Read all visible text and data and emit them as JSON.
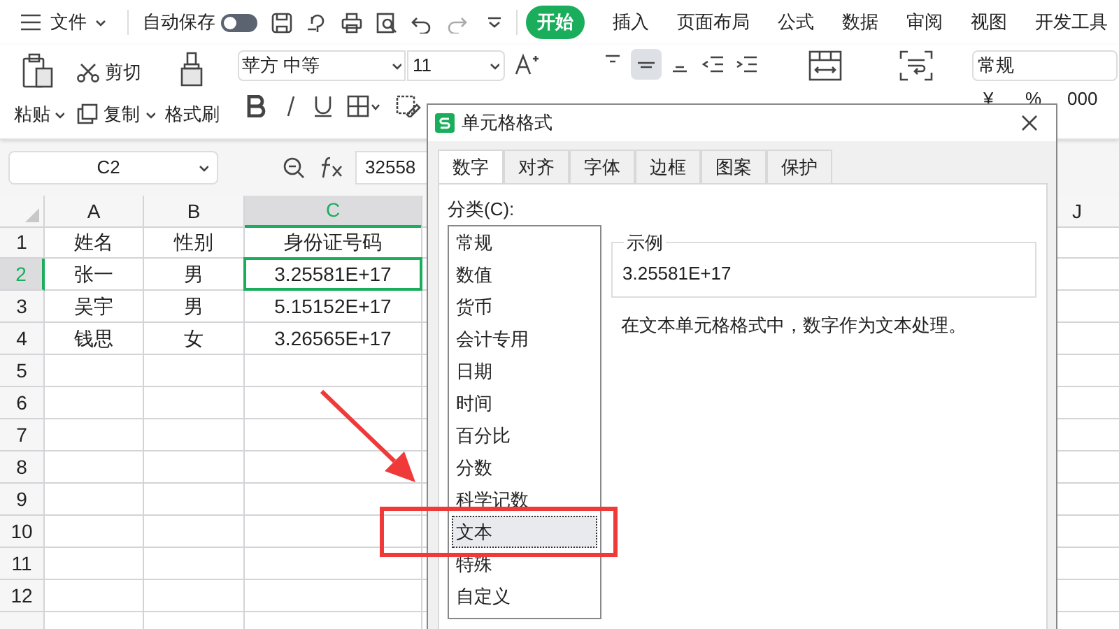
{
  "menu_bar": {
    "file_label": "文件",
    "autosave": {
      "label": "自动保存",
      "on": false
    },
    "tabs": [
      {
        "label": "开始",
        "selected": true
      },
      {
        "label": "插入",
        "selected": false
      },
      {
        "label": "页面布局",
        "selected": false
      },
      {
        "label": "公式",
        "selected": false
      },
      {
        "label": "数据",
        "selected": false
      },
      {
        "label": "审阅",
        "selected": false
      },
      {
        "label": "视图",
        "selected": false
      },
      {
        "label": "开发工具",
        "selected": false
      }
    ]
  },
  "ribbon": {
    "paste": "粘贴",
    "cut": "剪切",
    "copy": "复制",
    "format_painter": "格式刷",
    "font_name": "苹方 中等",
    "font_size": "11",
    "number_format": "常规",
    "number_buttons": [
      "¥",
      "%",
      "000"
    ]
  },
  "formula_bar": {
    "name_box": "C2",
    "value": "32558"
  },
  "sheet": {
    "columns": [
      {
        "label": "A",
        "selected": false
      },
      {
        "label": "B",
        "selected": false
      },
      {
        "label": "C",
        "selected": true
      }
    ],
    "right_column": "J",
    "rows": [
      {
        "number": "1",
        "selected": false,
        "cells": [
          {
            "text": "姓名",
            "selected": false
          },
          {
            "text": "性别",
            "selected": false
          },
          {
            "text": "身份证号码",
            "selected": false
          }
        ]
      },
      {
        "number": "2",
        "selected": true,
        "cells": [
          {
            "text": "张一",
            "selected": false
          },
          {
            "text": "男",
            "selected": false
          },
          {
            "text": "3.25581E+17",
            "selected": true
          }
        ]
      },
      {
        "number": "3",
        "selected": false,
        "cells": [
          {
            "text": "吴宇",
            "selected": false
          },
          {
            "text": "男",
            "selected": false
          },
          {
            "text": "5.15152E+17",
            "selected": false
          }
        ]
      },
      {
        "number": "4",
        "selected": false,
        "cells": [
          {
            "text": "钱思",
            "selected": false
          },
          {
            "text": "女",
            "selected": false
          },
          {
            "text": "3.26565E+17",
            "selected": false
          }
        ]
      },
      {
        "number": "5",
        "selected": false
      },
      {
        "number": "6",
        "selected": false
      },
      {
        "number": "7",
        "selected": false
      },
      {
        "number": "8",
        "selected": false
      },
      {
        "number": "9",
        "selected": false
      },
      {
        "number": "10",
        "selected": false
      },
      {
        "number": "11",
        "selected": false
      },
      {
        "number": "12",
        "selected": false
      }
    ]
  },
  "dialog": {
    "title": "单元格格式",
    "tabs": [
      {
        "label": "数字",
        "selected": true
      },
      {
        "label": "对齐",
        "selected": false
      },
      {
        "label": "字体",
        "selected": false
      },
      {
        "label": "边框",
        "selected": false
      },
      {
        "label": "图案",
        "selected": false
      },
      {
        "label": "保护",
        "selected": false
      }
    ],
    "category_label": "分类(C):",
    "categories": [
      {
        "label": "常规",
        "selected": false
      },
      {
        "label": "数值",
        "selected": false
      },
      {
        "label": "货币",
        "selected": false
      },
      {
        "label": "会计专用",
        "selected": false
      },
      {
        "label": "日期",
        "selected": false
      },
      {
        "label": "时间",
        "selected": false
      },
      {
        "label": "百分比",
        "selected": false
      },
      {
        "label": "分数",
        "selected": false
      },
      {
        "label": "科学记数",
        "selected": false
      },
      {
        "label": "文本",
        "selected": true
      },
      {
        "label": "特殊",
        "selected": false
      },
      {
        "label": "自定义",
        "selected": false
      }
    ],
    "sample_label": "示例",
    "sample_value": "3.25581E+17",
    "description": "在文本单元格格式中，数字作为文本处理。"
  },
  "annotations": {
    "pointer_arrow": true,
    "highlight_frame": true
  }
}
